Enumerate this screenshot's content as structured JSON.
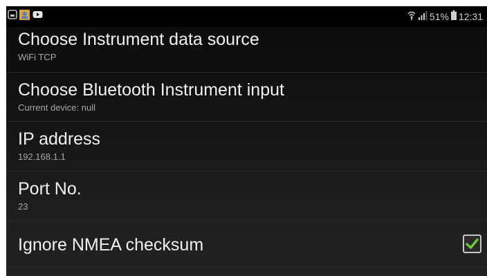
{
  "status_bar": {
    "notifications": [
      "gallery-icon",
      "contacts-icon",
      "youtube-icon"
    ],
    "wifi_icon": "wifi-icon",
    "signal_icon": "signal-icon",
    "battery_percent": "51%",
    "battery_icon": "battery-icon",
    "time": "12:31"
  },
  "preferences": [
    {
      "title": "Choose Instrument data source",
      "summary": "WiFi TCP"
    },
    {
      "title": "Choose Bluetooth Instrument input",
      "summary": "Current device: null"
    },
    {
      "title": "IP address",
      "summary": "192.168.1.1"
    },
    {
      "title": "Port No.",
      "summary": "23"
    }
  ],
  "checkbox_pref": {
    "title": "Ignore NMEA checksum",
    "checked": true
  },
  "colors": {
    "checkmark": "#6ecb3c",
    "title_text": "#f2f2f2",
    "summary_text": "#a8a8a8"
  }
}
